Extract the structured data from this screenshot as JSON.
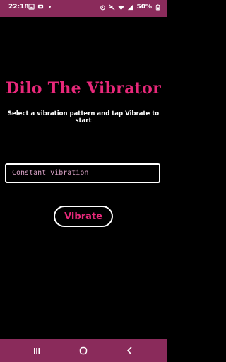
{
  "status_bar": {
    "time": "22:18",
    "battery_text": "50%",
    "icons": [
      "gallery-icon",
      "notification-icon",
      "dot-icon",
      "alarm-icon",
      "mute-icon",
      "wifi-icon",
      "signal-icon",
      "battery-icon"
    ]
  },
  "main": {
    "title": "Dilo The Vibrator",
    "subtitle": "Select a vibration pattern and tap Vibrate to start",
    "pattern_select": {
      "value": "Constant vibration"
    },
    "vibrate_button": {
      "label": "Vibrate"
    }
  },
  "colors": {
    "accent": "#e8287a",
    "bar": "#8a2b5b",
    "background": "#000000",
    "dropdown_text": "#d9a2c6"
  },
  "nav_bar": {
    "buttons": [
      "recents-icon",
      "home-icon",
      "back-icon"
    ]
  }
}
